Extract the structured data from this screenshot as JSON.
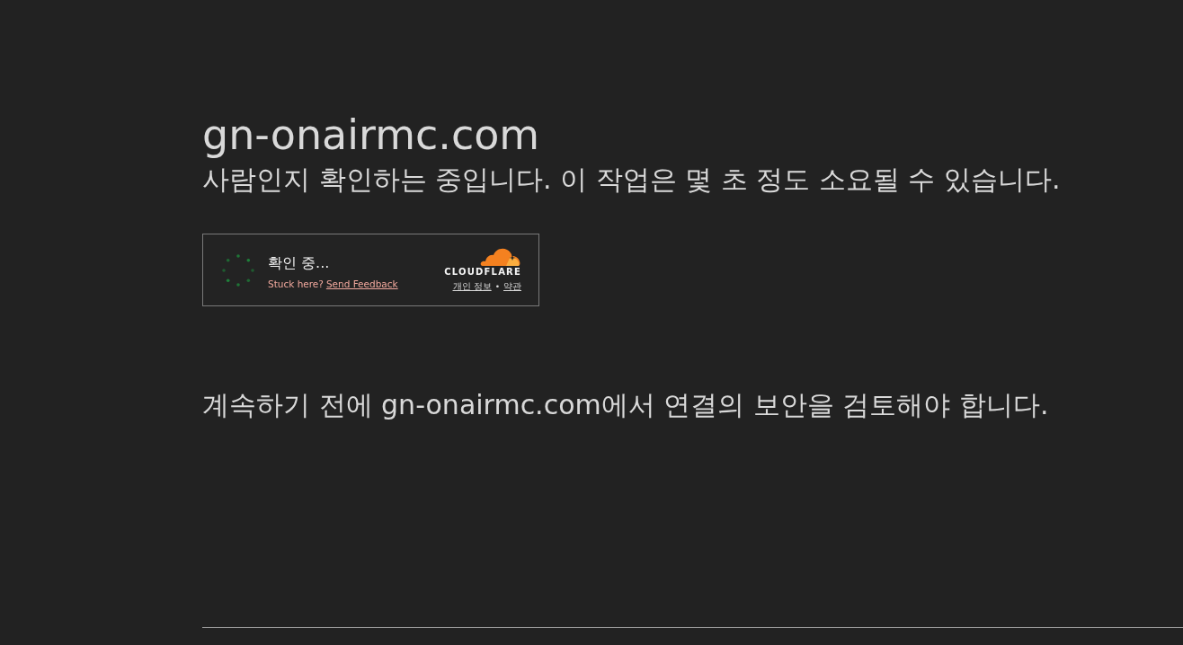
{
  "page": {
    "domain_title": "gn-onairmc.com",
    "subtitle": "사람인지 확인하는 중입니다. 이 작업은 몇 초 정도 소요될 수 있습니다."
  },
  "widget": {
    "status": "확인 중...",
    "stuck_text": "Stuck here?",
    "feedback_link": "Send Feedback",
    "brand": "CLOUDFLARE",
    "privacy_link": "개인 정보",
    "separator": "•",
    "terms_link": "약관"
  },
  "notice": "계속하기 전에 gn-onairmc.com에서 연결의 보안을 검토해야 합니다."
}
